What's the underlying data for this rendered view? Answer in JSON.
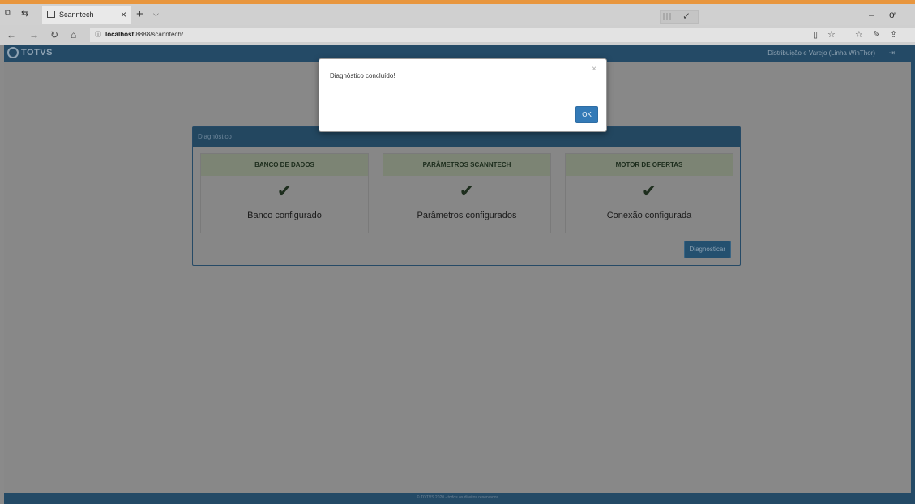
{
  "browser": {
    "tab_title": "Scanntech",
    "tab_close": "×",
    "new_tab": "+",
    "tab_dropdown": "⌵",
    "url_info": "ⓘ",
    "url_host": "localhost",
    "url_rest": ":8888/scanntech/",
    "window_controls": [
      "–",
      "ơ"
    ]
  },
  "app": {
    "logo_text": "TOTVS",
    "product_name": "Distribuição e Varejo (Linha WinThor)",
    "logout_icon": "⇥"
  },
  "panel": {
    "title": "Diagnóstico",
    "cards": [
      {
        "title": "BANCO DE DADOS",
        "status": "Banco configurado"
      },
      {
        "title": "PARÂMETROS SCANNTECH",
        "status": "Parâmetros configurados"
      },
      {
        "title": "MOTOR DE OFERTAS",
        "status": "Conexão configurada"
      }
    ],
    "check_glyph": "✔",
    "button_label": "Diagnosticar"
  },
  "modal": {
    "message": "Diagnóstico concluído!",
    "close": "×",
    "ok_label": "OK"
  },
  "footer": {
    "text": "© TOTVS 2020 - todos os direitos reservados"
  },
  "colors": {
    "header": "#244a66",
    "ok_button": "#337ab7",
    "accent_stripe": "#e8963e"
  }
}
